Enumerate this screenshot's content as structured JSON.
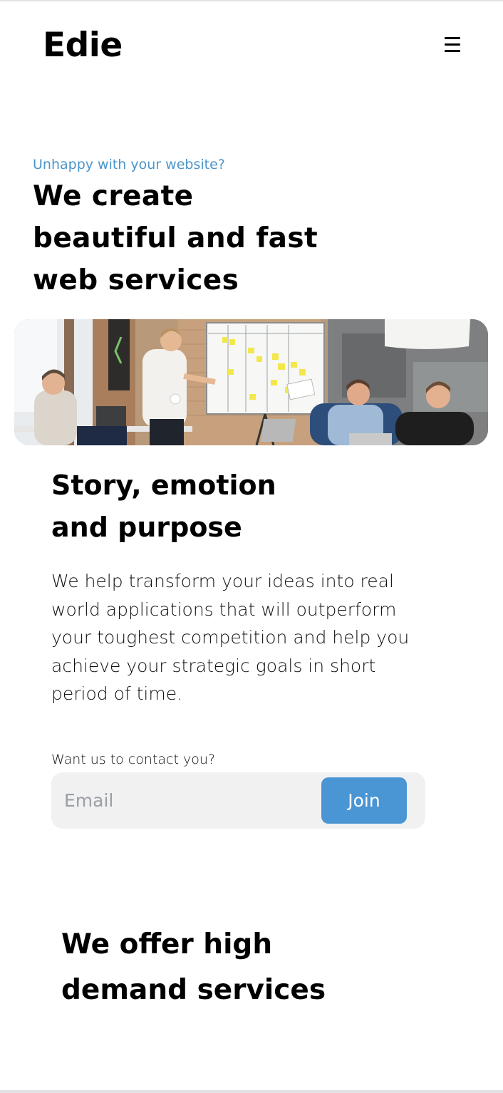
{
  "brand": {
    "logo_text": "Edie"
  },
  "nav": {
    "menu_icon": "hamburger-menu-icon"
  },
  "hero": {
    "eyebrow": "Unhappy with your website?",
    "title": "We create beautiful and fast web services",
    "image_alt": "Team meeting in front of a whiteboard with sticky notes"
  },
  "story": {
    "title": "Story, emotion and purpose",
    "body": "We help transform your ideas into real world applications that will outperform your toughest competition and help you achieve your strategic goals in short period of time."
  },
  "contact": {
    "label": "Want us to contact you?",
    "email_placeholder": "Email",
    "email_value": "",
    "join_label": "Join"
  },
  "services": {
    "title": "We offer high demand services"
  },
  "colors": {
    "accent": "#4a95d3",
    "eyebrow": "#4a95c9",
    "field_bg": "#f1f1f1"
  }
}
